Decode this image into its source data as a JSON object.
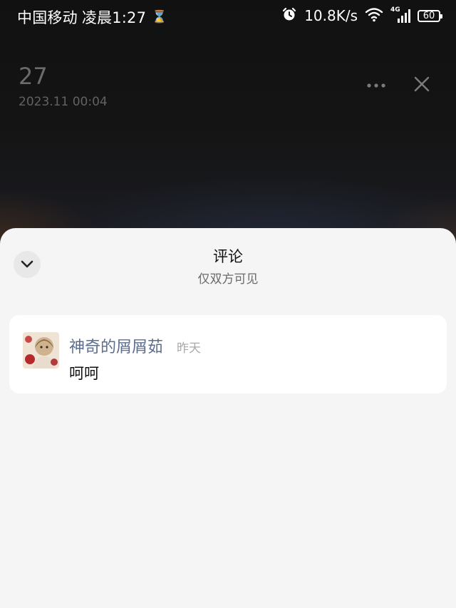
{
  "status_bar": {
    "carrier": "中国移动",
    "time": "凌晨1:27",
    "network_speed": "10.8K/s",
    "network_type": "4G",
    "battery": "60",
    "icons": [
      "hourglass-icon",
      "alarm-icon",
      "wifi-icon",
      "signal-icon",
      "battery-icon"
    ]
  },
  "header": {
    "day": "27",
    "date": "2023.11 00:04",
    "more_icon": "more-icon",
    "close_icon": "close-icon"
  },
  "comments_sheet": {
    "title": "评论",
    "subtitle": "仅双方可见",
    "collapse_icon": "chevron-down-icon",
    "comments": [
      {
        "author": "神奇的屑屑茹",
        "time": "昨天",
        "text": "呵呵"
      }
    ]
  },
  "colors": {
    "sheet_background": "#f5f5f5",
    "card_background": "#ffffff",
    "author_name": "#5c6d8e",
    "muted_text": "#a9a9a9"
  }
}
